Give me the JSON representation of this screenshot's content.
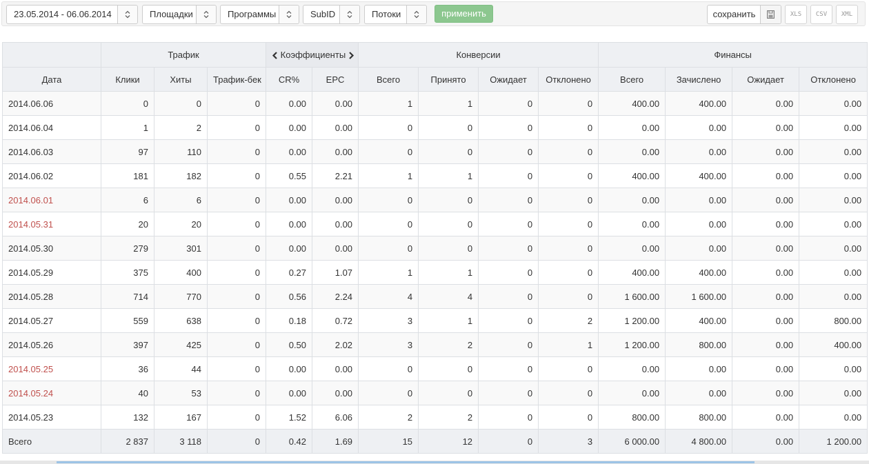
{
  "filters": {
    "date_range": "23.05.2014 - 06.06.2014",
    "platforms": "Площадки",
    "programs": "Программы",
    "subid": "SubID",
    "streams": "Потоки",
    "apply_label": "применить"
  },
  "export": {
    "save_label": "сохранить",
    "xls": "XLS",
    "csv": "CSV",
    "xml": "XML"
  },
  "colors": {
    "apply_button": "#8cc78f",
    "weekend_date": "#c0504d",
    "header_bg": "#eef0f3"
  },
  "table": {
    "groups": {
      "traffic": "Трафик",
      "coefficients": "Коэффициенты",
      "conversions": "Конверсии",
      "finance": "Финансы"
    },
    "columns": {
      "date": "Дата",
      "clicks": "Клики",
      "hits": "Хиты",
      "trafback": "Трафик-бек",
      "cr": "CR%",
      "epc": "EPC",
      "conv_total": "Всего",
      "conv_accepted": "Принято",
      "conv_pending": "Ожидает",
      "conv_rejected": "Отклонено",
      "fin_total": "Всего",
      "fin_credited": "Зачислено",
      "fin_pending": "Ожидает",
      "fin_rejected": "Отклонено"
    },
    "rows": [
      {
        "date": "2014.06.06",
        "weekend": false,
        "clicks": "0",
        "hits": "0",
        "trafback": "0",
        "cr": "0.00",
        "epc": "0.00",
        "conv_total": "1",
        "conv_accepted": "1",
        "conv_pending": "0",
        "conv_rejected": "0",
        "fin_total": "400.00",
        "fin_credited": "400.00",
        "fin_pending": "0.00",
        "fin_rejected": "0.00"
      },
      {
        "date": "2014.06.04",
        "weekend": false,
        "clicks": "1",
        "hits": "2",
        "trafback": "0",
        "cr": "0.00",
        "epc": "0.00",
        "conv_total": "0",
        "conv_accepted": "0",
        "conv_pending": "0",
        "conv_rejected": "0",
        "fin_total": "0.00",
        "fin_credited": "0.00",
        "fin_pending": "0.00",
        "fin_rejected": "0.00"
      },
      {
        "date": "2014.06.03",
        "weekend": false,
        "clicks": "97",
        "hits": "110",
        "trafback": "0",
        "cr": "0.00",
        "epc": "0.00",
        "conv_total": "0",
        "conv_accepted": "0",
        "conv_pending": "0",
        "conv_rejected": "0",
        "fin_total": "0.00",
        "fin_credited": "0.00",
        "fin_pending": "0.00",
        "fin_rejected": "0.00"
      },
      {
        "date": "2014.06.02",
        "weekend": false,
        "clicks": "181",
        "hits": "182",
        "trafback": "0",
        "cr": "0.55",
        "epc": "2.21",
        "conv_total": "1",
        "conv_accepted": "1",
        "conv_pending": "0",
        "conv_rejected": "0",
        "fin_total": "400.00",
        "fin_credited": "400.00",
        "fin_pending": "0.00",
        "fin_rejected": "0.00"
      },
      {
        "date": "2014.06.01",
        "weekend": true,
        "clicks": "6",
        "hits": "6",
        "trafback": "0",
        "cr": "0.00",
        "epc": "0.00",
        "conv_total": "0",
        "conv_accepted": "0",
        "conv_pending": "0",
        "conv_rejected": "0",
        "fin_total": "0.00",
        "fin_credited": "0.00",
        "fin_pending": "0.00",
        "fin_rejected": "0.00"
      },
      {
        "date": "2014.05.31",
        "weekend": true,
        "clicks": "20",
        "hits": "20",
        "trafback": "0",
        "cr": "0.00",
        "epc": "0.00",
        "conv_total": "0",
        "conv_accepted": "0",
        "conv_pending": "0",
        "conv_rejected": "0",
        "fin_total": "0.00",
        "fin_credited": "0.00",
        "fin_pending": "0.00",
        "fin_rejected": "0.00"
      },
      {
        "date": "2014.05.30",
        "weekend": false,
        "clicks": "279",
        "hits": "301",
        "trafback": "0",
        "cr": "0.00",
        "epc": "0.00",
        "conv_total": "0",
        "conv_accepted": "0",
        "conv_pending": "0",
        "conv_rejected": "0",
        "fin_total": "0.00",
        "fin_credited": "0.00",
        "fin_pending": "0.00",
        "fin_rejected": "0.00"
      },
      {
        "date": "2014.05.29",
        "weekend": false,
        "clicks": "375",
        "hits": "400",
        "trafback": "0",
        "cr": "0.27",
        "epc": "1.07",
        "conv_total": "1",
        "conv_accepted": "1",
        "conv_pending": "0",
        "conv_rejected": "0",
        "fin_total": "400.00",
        "fin_credited": "400.00",
        "fin_pending": "0.00",
        "fin_rejected": "0.00"
      },
      {
        "date": "2014.05.28",
        "weekend": false,
        "clicks": "714",
        "hits": "770",
        "trafback": "0",
        "cr": "0.56",
        "epc": "2.24",
        "conv_total": "4",
        "conv_accepted": "4",
        "conv_pending": "0",
        "conv_rejected": "0",
        "fin_total": "1 600.00",
        "fin_credited": "1 600.00",
        "fin_pending": "0.00",
        "fin_rejected": "0.00"
      },
      {
        "date": "2014.05.27",
        "weekend": false,
        "clicks": "559",
        "hits": "638",
        "trafback": "0",
        "cr": "0.18",
        "epc": "0.72",
        "conv_total": "3",
        "conv_accepted": "1",
        "conv_pending": "0",
        "conv_rejected": "2",
        "fin_total": "1 200.00",
        "fin_credited": "400.00",
        "fin_pending": "0.00",
        "fin_rejected": "800.00"
      },
      {
        "date": "2014.05.26",
        "weekend": false,
        "clicks": "397",
        "hits": "425",
        "trafback": "0",
        "cr": "0.50",
        "epc": "2.02",
        "conv_total": "3",
        "conv_accepted": "2",
        "conv_pending": "0",
        "conv_rejected": "1",
        "fin_total": "1 200.00",
        "fin_credited": "800.00",
        "fin_pending": "0.00",
        "fin_rejected": "400.00"
      },
      {
        "date": "2014.05.25",
        "weekend": true,
        "clicks": "36",
        "hits": "44",
        "trafback": "0",
        "cr": "0.00",
        "epc": "0.00",
        "conv_total": "0",
        "conv_accepted": "0",
        "conv_pending": "0",
        "conv_rejected": "0",
        "fin_total": "0.00",
        "fin_credited": "0.00",
        "fin_pending": "0.00",
        "fin_rejected": "0.00"
      },
      {
        "date": "2014.05.24",
        "weekend": true,
        "clicks": "40",
        "hits": "53",
        "trafback": "0",
        "cr": "0.00",
        "epc": "0.00",
        "conv_total": "0",
        "conv_accepted": "0",
        "conv_pending": "0",
        "conv_rejected": "0",
        "fin_total": "0.00",
        "fin_credited": "0.00",
        "fin_pending": "0.00",
        "fin_rejected": "0.00"
      },
      {
        "date": "2014.05.23",
        "weekend": false,
        "clicks": "132",
        "hits": "167",
        "trafback": "0",
        "cr": "1.52",
        "epc": "6.06",
        "conv_total": "2",
        "conv_accepted": "2",
        "conv_pending": "0",
        "conv_rejected": "0",
        "fin_total": "800.00",
        "fin_credited": "800.00",
        "fin_pending": "0.00",
        "fin_rejected": "0.00"
      }
    ],
    "totals": {
      "date": "Всего",
      "clicks": "2 837",
      "hits": "3 118",
      "trafback": "0",
      "cr": "0.42",
      "epc": "1.69",
      "conv_total": "15",
      "conv_accepted": "12",
      "conv_pending": "0",
      "conv_rejected": "3",
      "fin_total": "6 000.00",
      "fin_credited": "4 800.00",
      "fin_pending": "0.00",
      "fin_rejected": "1 200.00"
    }
  }
}
